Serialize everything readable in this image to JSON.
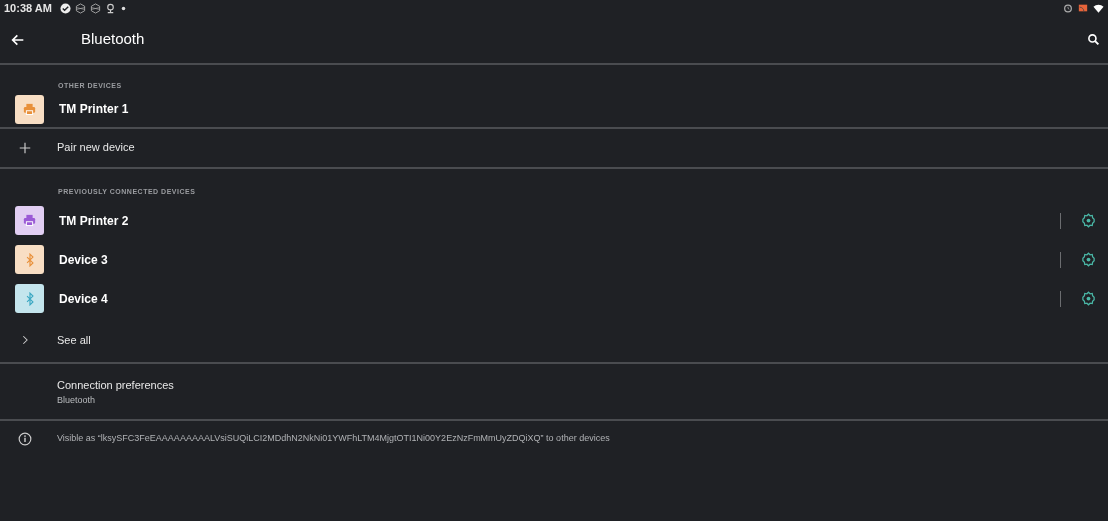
{
  "status_bar": {
    "time": "10:38 AM"
  },
  "header": {
    "title": "Bluetooth"
  },
  "other_devices": {
    "heading": "OTHER DEVICES",
    "devices": [
      {
        "name": "TM Printer 1",
        "kind": "printer",
        "color": "#e8903a"
      }
    ]
  },
  "pair_new": {
    "label": "Pair new device"
  },
  "previous_devices": {
    "heading": "PREVIOUSLY CONNECTED DEVICES",
    "devices": [
      {
        "name": "TM Printer 2",
        "kind": "printer",
        "color": "#9b5bd6"
      },
      {
        "name": "Device 3",
        "kind": "bluetooth",
        "color": "#e8903a"
      },
      {
        "name": "Device 4",
        "kind": "bluetooth",
        "color": "#3aa7c2"
      }
    ]
  },
  "see_all": {
    "label": "See all"
  },
  "connection_preferences": {
    "title": "Connection preferences",
    "subtitle": "Bluetooth"
  },
  "visible_note": {
    "text": "Visible as “lksySFC3FeEAAAAAAAAALVsiSUQiLCI2MDdhN2NkNi01YWFhLTM4MjgtOTI1Ni00Y2EzNzFmMmUyZDQiXQ” to other devices"
  }
}
